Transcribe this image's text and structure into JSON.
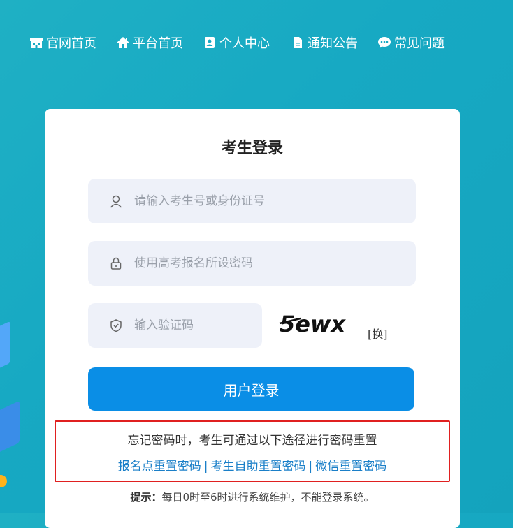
{
  "nav": [
    {
      "label": "官网首页",
      "icon": "building-icon"
    },
    {
      "label": "平台首页",
      "icon": "home-icon"
    },
    {
      "label": "个人中心",
      "icon": "contact-card-icon"
    },
    {
      "label": "通知公告",
      "icon": "document-icon"
    },
    {
      "label": "常见问题",
      "icon": "chat-bubble-icon"
    }
  ],
  "login": {
    "title": "考生登录",
    "username_placeholder": "请输入考生号或身份证号",
    "password_placeholder": "使用高考报名所设密码",
    "captcha_placeholder": "输入验证码",
    "captcha_text": "5ewx",
    "captcha_refresh": "[换]",
    "submit_label": "用户登录"
  },
  "reset": {
    "description": "忘记密码时，考生可通过以下途径进行密码重置",
    "links": [
      "报名点重置密码",
      "考生自助重置密码",
      "微信重置密码"
    ],
    "separator": "|",
    "highlight_color": "#e02020"
  },
  "tip": {
    "label": "提示：",
    "text": "每日0时至6时进行系统维护，不能登录系统。"
  },
  "colors": {
    "background": "#17a9c3",
    "primary": "#0a8ee6",
    "link": "#1a7fc8"
  }
}
